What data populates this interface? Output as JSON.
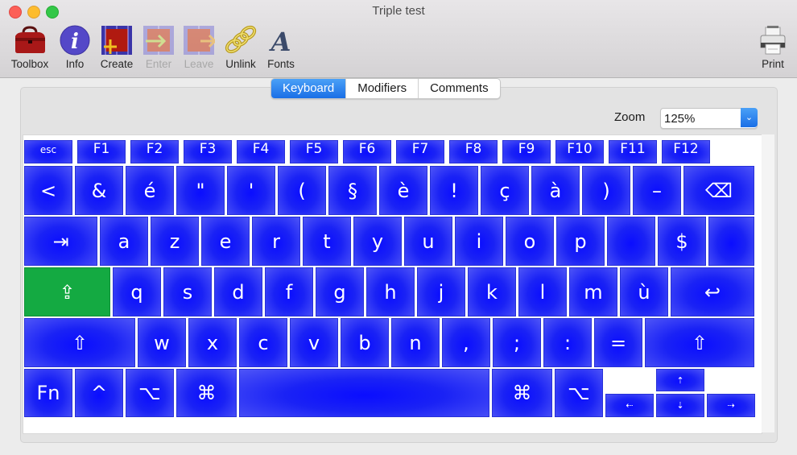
{
  "window": {
    "title": "Triple test"
  },
  "toolbar": {
    "items": [
      {
        "label": "Toolbox",
        "icon": "toolbox-icon",
        "enabled": true
      },
      {
        "label": "Info",
        "icon": "info-icon",
        "enabled": true
      },
      {
        "label": "Create",
        "icon": "create-icon",
        "enabled": true
      },
      {
        "label": "Enter",
        "icon": "enter-icon",
        "enabled": false
      },
      {
        "label": "Leave",
        "icon": "leave-icon",
        "enabled": false
      },
      {
        "label": "Unlink",
        "icon": "chain-link-icon",
        "enabled": true
      },
      {
        "label": "Fonts",
        "icon": "font-icon",
        "enabled": true
      }
    ],
    "print_label": "Print"
  },
  "tabs": [
    {
      "label": "Keyboard",
      "active": true
    },
    {
      "label": "Modifiers",
      "active": false
    },
    {
      "label": "Comments",
      "active": false
    }
  ],
  "zoom": {
    "label": "Zoom",
    "value": "125%"
  },
  "keyboard": {
    "function_row": [
      "esc",
      "F1",
      "F2",
      "F3",
      "F4",
      "F5",
      "F6",
      "F7",
      "F8",
      "F9",
      "F10",
      "F11",
      "F12"
    ],
    "row1": [
      "<",
      "&",
      "é",
      "\"",
      "'",
      "(",
      "§",
      "è",
      "!",
      "ç",
      "à",
      ")",
      "–",
      "⌫"
    ],
    "row2": [
      "⇥",
      "a",
      "z",
      "e",
      "r",
      "t",
      "y",
      "u",
      "i",
      "o",
      "p",
      "",
      "$",
      ""
    ],
    "row3": [
      "⇪",
      "q",
      "s",
      "d",
      "f",
      "g",
      "h",
      "j",
      "k",
      "l",
      "m",
      "ù",
      "↩"
    ],
    "row4": [
      "⇧",
      "w",
      "x",
      "c",
      "v",
      "b",
      "n",
      ",",
      ";",
      ":",
      "=",
      "⇧"
    ],
    "row5": [
      "Fn",
      "^",
      "⌥",
      "⌘",
      "",
      "⌘",
      "⌥"
    ],
    "arrows": {
      "up": "⇡",
      "left": "⇠",
      "down": "⇣",
      "right": "⇢"
    },
    "highlighted_key": "⇪",
    "key_color": "#1a22f5",
    "highlight_color": "#14aa42"
  }
}
